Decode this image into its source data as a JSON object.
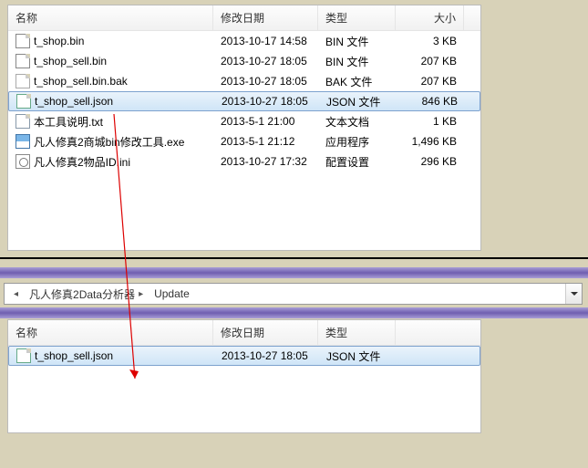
{
  "top": {
    "columns": {
      "name": "名称",
      "date": "修改日期",
      "type": "类型",
      "size": "大小"
    },
    "files": [
      {
        "name": "t_shop.bin",
        "date": "2013-10-17 14:58",
        "type": "BIN 文件",
        "size": "3 KB",
        "icon": "file",
        "selected": false
      },
      {
        "name": "t_shop_sell.bin",
        "date": "2013-10-27 18:05",
        "type": "BIN 文件",
        "size": "207 KB",
        "icon": "file",
        "selected": false
      },
      {
        "name": "t_shop_sell.bin.bak",
        "date": "2013-10-27 18:05",
        "type": "BAK 文件",
        "size": "207 KB",
        "icon": "bak",
        "selected": false
      },
      {
        "name": "t_shop_sell.json",
        "date": "2013-10-27 18:05",
        "type": "JSON 文件",
        "size": "846 KB",
        "icon": "json",
        "selected": true
      },
      {
        "name": "本工具说明.txt",
        "date": "2013-5-1 21:00",
        "type": "文本文档",
        "size": "1 KB",
        "icon": "txt",
        "selected": false
      },
      {
        "name": "凡人修真2商城bin修改工具.exe",
        "date": "2013-5-1 21:12",
        "type": "应用程序",
        "size": "1,496 KB",
        "icon": "exe",
        "selected": false
      },
      {
        "name": "凡人修真2物品ID.ini",
        "date": "2013-10-27 17:32",
        "type": "配置设置",
        "size": "296 KB",
        "icon": "ini",
        "selected": false
      }
    ]
  },
  "breadcrumb": {
    "segments": [
      "凡人修真2Data分析器",
      "Update"
    ]
  },
  "bottom": {
    "columns": {
      "name": "名称",
      "date": "修改日期",
      "type": "类型"
    },
    "files": [
      {
        "name": "t_shop_sell.json",
        "date": "2013-10-27 18:05",
        "type": "JSON 文件",
        "icon": "json",
        "selected": true
      }
    ]
  }
}
